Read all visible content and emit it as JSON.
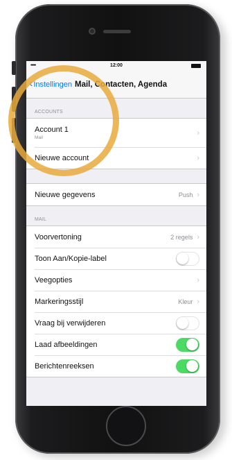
{
  "status_bar": {
    "signal": "•••••",
    "time": "12:00"
  },
  "nav": {
    "back_label": "Instellingen",
    "title": "Mail, Contacten, Agenda"
  },
  "accounts": {
    "header": "ACCOUNTS",
    "items": [
      {
        "label": "Account 1",
        "sub": "Mail"
      },
      {
        "label": "Nieuwe account"
      }
    ]
  },
  "fetch": {
    "label": "Nieuwe gegevens",
    "value": "Push"
  },
  "mail": {
    "header": "MAIL",
    "items": [
      {
        "label": "Voorvertoning",
        "value": "2 regels"
      },
      {
        "label": "Toon Aan/Kopie-label",
        "toggle": false
      },
      {
        "label": "Veegopties"
      },
      {
        "label": "Markeringsstijl",
        "value": "Kleur"
      },
      {
        "label": "Vraag bij verwijderen",
        "toggle": false
      },
      {
        "label": "Laad afbeeldingen",
        "toggle": true
      },
      {
        "label": "Berichtenreeksen",
        "toggle": true
      }
    ]
  },
  "colors": {
    "accent": "#007aff",
    "toggle_on": "#4cd964",
    "highlight": "#e8aa3c"
  }
}
